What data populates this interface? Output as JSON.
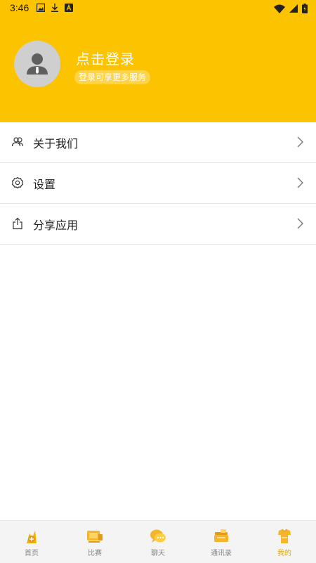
{
  "status_bar": {
    "time": "3:46",
    "left_icons": [
      "image-icon",
      "download-icon",
      "a-icon"
    ],
    "right_icons": [
      "wifi-icon",
      "signal-icon",
      "battery-icon"
    ]
  },
  "profile": {
    "login_title": "点击登录",
    "login_subtitle": "登录可享更多服务",
    "avatar_icon": "person-icon"
  },
  "menu": {
    "items": [
      {
        "label": "关于我们",
        "icon": "people-icon"
      },
      {
        "label": "设置",
        "icon": "gear-icon"
      },
      {
        "label": "分享应用",
        "icon": "share-icon"
      }
    ]
  },
  "tabbar": {
    "items": [
      {
        "label": "首页",
        "icon": "home-icon"
      },
      {
        "label": "比赛",
        "icon": "match-icon"
      },
      {
        "label": "聊天",
        "icon": "chat-icon"
      },
      {
        "label": "通讯录",
        "icon": "contacts-icon"
      },
      {
        "label": "我的",
        "icon": "profile-icon"
      }
    ],
    "active": "我的"
  },
  "colors": {
    "header": "#FCC300",
    "accent": "#E0A800",
    "divider": "#e6e6e6"
  }
}
